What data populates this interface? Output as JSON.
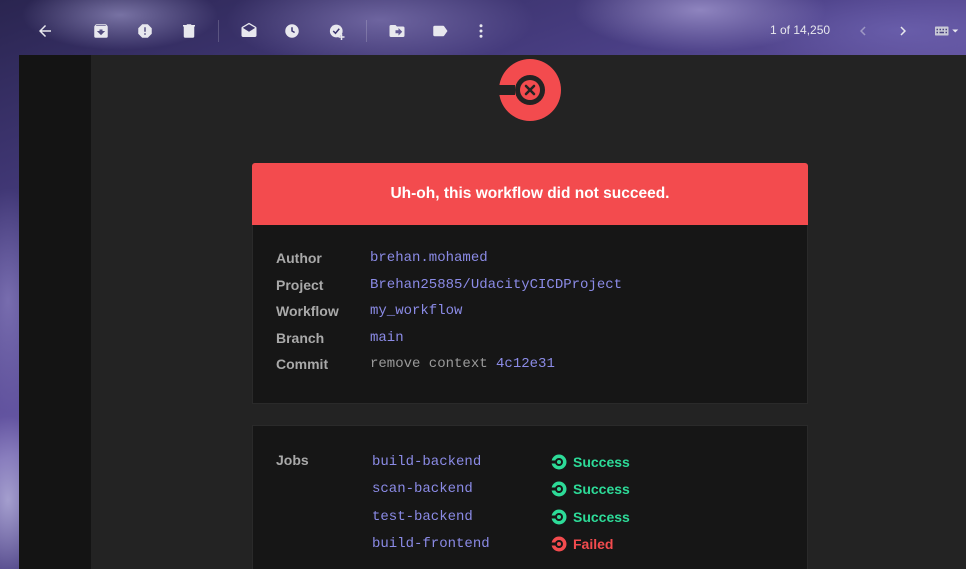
{
  "toolbar": {
    "buttons": [
      {
        "name": "back-arrow-icon"
      },
      {
        "name": "archive-icon"
      },
      {
        "name": "report-spam-icon"
      },
      {
        "name": "delete-icon"
      },
      {
        "name": "mark-unread-icon"
      },
      {
        "name": "snooze-icon"
      },
      {
        "name": "add-task-icon"
      },
      {
        "name": "move-to-icon"
      },
      {
        "name": "label-icon"
      },
      {
        "name": "more-icon"
      }
    ],
    "pager_text": "1 of 14,250"
  },
  "email": {
    "banner_text": "Uh-oh, this workflow did not succeed.",
    "details": [
      {
        "label": "Author",
        "value": "brehan.mohamed"
      },
      {
        "label": "Project",
        "value": "Brehan25885/UdacityCICDProject"
      },
      {
        "label": "Workflow",
        "value": "my_workflow"
      },
      {
        "label": "Branch",
        "value": "main"
      },
      {
        "label": "Commit",
        "value": "remove context",
        "hash": "4c12e31"
      }
    ],
    "jobs_label": "Jobs",
    "jobs": [
      {
        "name": "build-backend",
        "status": "Success"
      },
      {
        "name": "scan-backend",
        "status": "Success"
      },
      {
        "name": "test-backend",
        "status": "Success"
      },
      {
        "name": "build-frontend",
        "status": "Failed"
      }
    ]
  },
  "colors": {
    "accent_red": "#f34b4e",
    "success_green": "#2ddb98",
    "link_purple": "#8b8be6"
  }
}
